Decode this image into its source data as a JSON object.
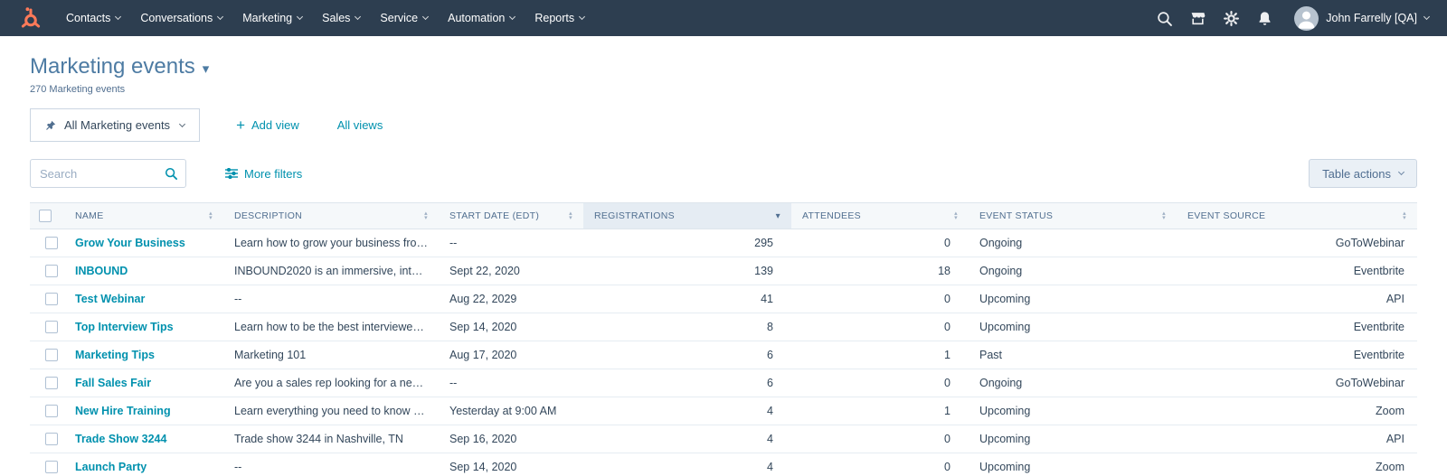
{
  "colors": {
    "brand_orange": "#ff7a59",
    "link_teal": "#0091ae",
    "nav_bg": "#2d3e50",
    "title_blue": "#4d7ba3"
  },
  "icons": {
    "dropdown_caret": "▾",
    "sort_up": "▴",
    "sort_down": "▾",
    "plus": "+"
  },
  "nav": {
    "items": [
      "Contacts",
      "Conversations",
      "Marketing",
      "Sales",
      "Service",
      "Automation",
      "Reports"
    ],
    "user_name": "John Farrelly [QA]"
  },
  "header": {
    "title": "Marketing events",
    "count_label": "270 Marketing events"
  },
  "views": {
    "active_tab": "All Marketing events",
    "add_view_label": "Add view",
    "all_views_label": "All views"
  },
  "toolbar": {
    "search_placeholder": "Search",
    "more_filters_label": "More filters",
    "table_actions_label": "Table actions"
  },
  "table": {
    "columns": [
      "NAME",
      "DESCRIPTION",
      "START DATE (EDT)",
      "REGISTRATIONS",
      "ATTENDEES",
      "EVENT STATUS",
      "EVENT SOURCE"
    ],
    "sorted_column": "REGISTRATIONS",
    "rows": [
      {
        "name": "Grow Your Business",
        "description": "Learn how to grow your business fro…",
        "start_date": "--",
        "registrations": "295",
        "attendees": "0",
        "status": "Ongoing",
        "source": "GoToWebinar"
      },
      {
        "name": "INBOUND",
        "description": "INBOUND2020 is an immersive, inter…",
        "start_date": "Sept 22, 2020",
        "registrations": "139",
        "attendees": "18",
        "status": "Ongoing",
        "source": "Eventbrite"
      },
      {
        "name": "Test Webinar",
        "description": "--",
        "start_date": "Aug 22, 2029",
        "registrations": "41",
        "attendees": "0",
        "status": "Upcoming",
        "source": "API"
      },
      {
        "name": "Top Interview Tips",
        "description": "Learn how to be the best interviewer …",
        "start_date": "Sep 14, 2020",
        "registrations": "8",
        "attendees": "0",
        "status": "Upcoming",
        "source": "Eventbrite"
      },
      {
        "name": "Marketing Tips",
        "description": "Marketing 101",
        "start_date": "Aug 17, 2020",
        "registrations": "6",
        "attendees": "1",
        "status": "Past",
        "source": "Eventbrite"
      },
      {
        "name": "Fall Sales Fair",
        "description": "Are you a sales rep looking for a new…",
        "start_date": "--",
        "registrations": "6",
        "attendees": "0",
        "status": "Ongoing",
        "source": "GoToWebinar"
      },
      {
        "name": "New Hire Training",
        "description": "Learn everything you need to know a…",
        "start_date": "Yesterday at 9:00 AM",
        "registrations": "4",
        "attendees": "1",
        "status": "Upcoming",
        "source": "Zoom"
      },
      {
        "name": "Trade Show 3244",
        "description": "Trade show 3244 in Nashville, TN",
        "start_date": "Sep 16, 2020",
        "registrations": "4",
        "attendees": "0",
        "status": "Upcoming",
        "source": "API"
      },
      {
        "name": "Launch Party",
        "description": "--",
        "start_date": "Sep 14, 2020",
        "registrations": "4",
        "attendees": "0",
        "status": "Upcoming",
        "source": "Zoom"
      }
    ]
  }
}
